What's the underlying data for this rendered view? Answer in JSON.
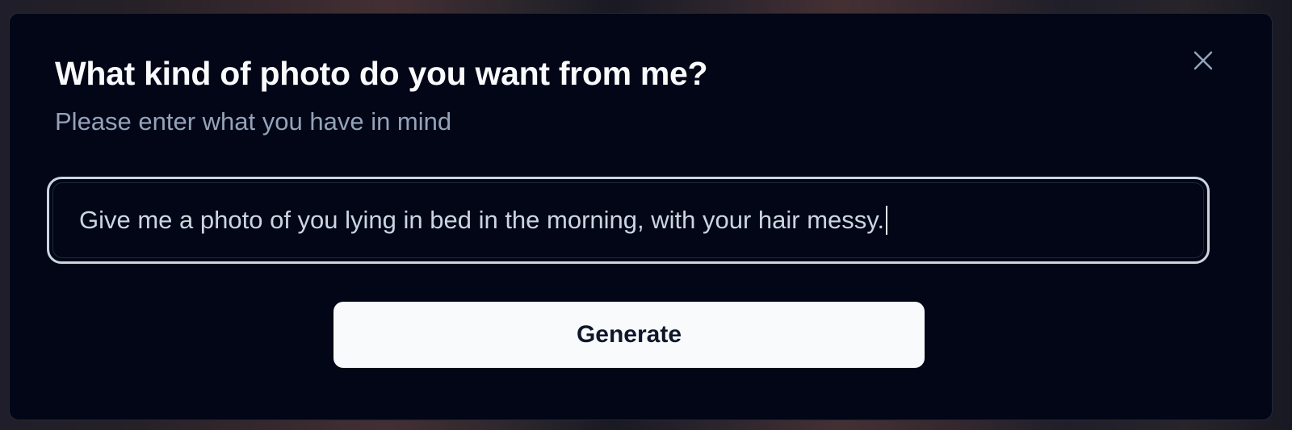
{
  "dialog": {
    "title": "What kind of photo do you want from me?",
    "subtitle": "Please enter what you have in mind",
    "close_icon": "close-icon",
    "prompt": {
      "value": "Give me a photo of you lying in bed in the morning, with your hair messy.",
      "placeholder": ""
    },
    "generate_label": "Generate"
  },
  "colors": {
    "dialog_background": "#020617",
    "title": "#f8fafc",
    "subtitle": "#94a3b8",
    "input_ring": "#cbd5e1",
    "button_background": "#f8fafc",
    "button_text": "#0f172a"
  }
}
